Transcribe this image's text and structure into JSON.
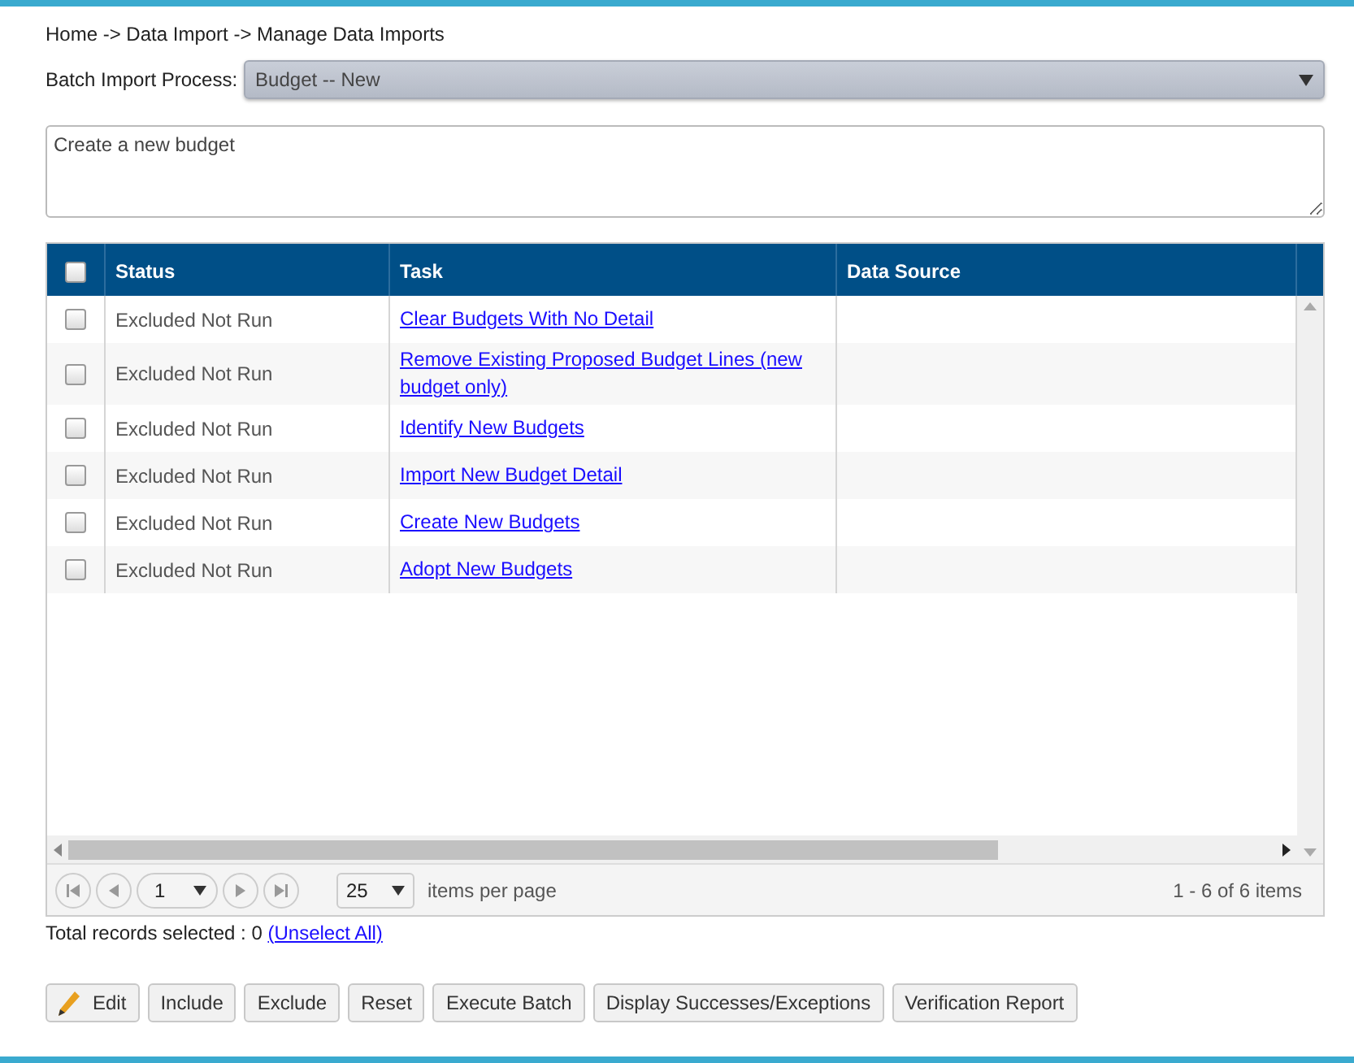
{
  "breadcrumb": "Home -> Data Import -> Manage Data Imports",
  "batch_process": {
    "label": "Batch Import Process:",
    "value": "Budget -- New"
  },
  "description": {
    "value": "Create a new budget"
  },
  "grid": {
    "select_all_checked": false,
    "columns": [
      "Status",
      "Task",
      "Data Source"
    ],
    "rows": [
      {
        "checked": false,
        "status": "Excluded Not Run",
        "task": "Clear Budgets With No Detail"
      },
      {
        "checked": false,
        "status": "Excluded Not Run",
        "task": "Remove Existing Proposed Budget Lines (new budget only)"
      },
      {
        "checked": false,
        "status": "Excluded Not Run",
        "task": "Identify New Budgets"
      },
      {
        "checked": false,
        "status": "Excluded Not Run",
        "task": "Import New Budget Detail"
      },
      {
        "checked": false,
        "status": "Excluded Not Run",
        "task": "Create New Budgets"
      },
      {
        "checked": false,
        "status": "Excluded Not Run",
        "task": "Adopt New Budgets"
      }
    ],
    "pager": {
      "page": "1",
      "page_size": "25",
      "page_size_label": "items per page",
      "summary": "1 - 6 of 6 items"
    }
  },
  "selection": {
    "text": "Total records selected : 0",
    "link": "(Unselect All)"
  },
  "buttons": [
    {
      "label": "Edit",
      "kind": "edit"
    },
    {
      "label": "Include",
      "kind": "plain"
    },
    {
      "label": "Exclude",
      "kind": "plain"
    },
    {
      "label": "Reset",
      "kind": "plain"
    },
    {
      "label": "Execute Batch",
      "kind": "plain"
    },
    {
      "label": "Display Successes/Exceptions",
      "kind": "plain"
    },
    {
      "label": "Verification Report",
      "kind": "plain"
    }
  ]
}
